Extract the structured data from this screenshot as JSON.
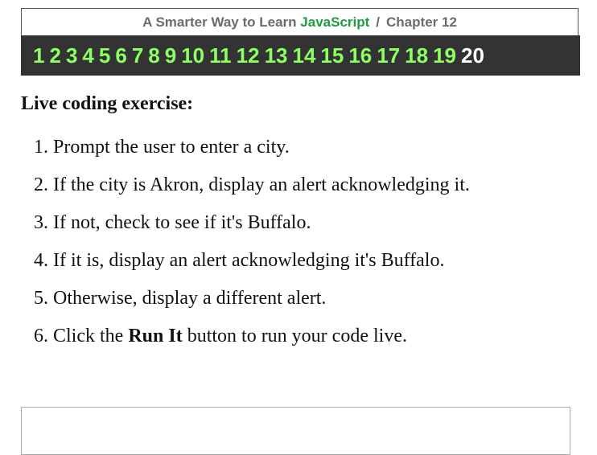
{
  "header": {
    "prefix": "A Smarter Way to Learn",
    "brand": "JavaScript",
    "separator": "/",
    "chapter": "Chapter 12"
  },
  "chapter_nav": [
    "1",
    "2",
    "3",
    "4",
    "5",
    "6",
    "7",
    "8",
    "9",
    "10",
    "11",
    "12",
    "13",
    "14",
    "15",
    "16",
    "17",
    "18",
    "19",
    "20"
  ],
  "current_chapter": "20",
  "exercise": {
    "title": "Live coding exercise:",
    "steps": [
      "Prompt the user to enter a city.",
      "If the city is Akron, display an alert acknowledging it.",
      "If not, check to see if it's Buffalo.",
      "If it is, display an alert acknowledging it's Buffalo.",
      "Otherwise, display a different alert."
    ],
    "last_step": {
      "before": "Click the ",
      "bold": "Run It",
      "after": " button to run your code live."
    }
  },
  "colors": {
    "brand": "#1e9e3a",
    "nav_bg": "#333333",
    "nav_link": "#8cff63",
    "nav_current": "#ffffff"
  }
}
